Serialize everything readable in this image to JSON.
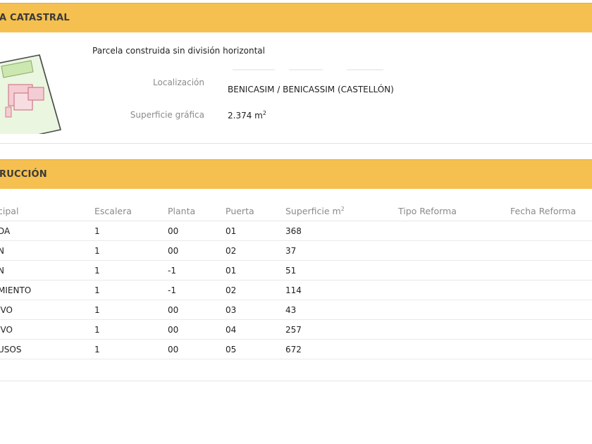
{
  "sections": {
    "catastral": {
      "title": "A CATASTRAL"
    },
    "construccion": {
      "title": "RUCCIÓN"
    }
  },
  "parcel": {
    "description": "Parcela construida sin división horizontal",
    "localizacion_label": "Localización",
    "localizacion_value": "BENICASIM / BENICASSIM (CASTELLÓN)",
    "superficie_label": "Superficie gráfica",
    "superficie_value": "2.374 m",
    "superficie_unit_sup": "2"
  },
  "table": {
    "headers": [
      "cipal",
      "Escalera",
      "Planta",
      "Puerta",
      "Superficie m",
      "Tipo Reforma",
      "Fecha Reforma"
    ],
    "superficie_header_sup": "2",
    "rows": [
      [
        "DA",
        "1",
        "00",
        "01",
        "368",
        "",
        ""
      ],
      [
        "N",
        "1",
        "00",
        "02",
        "37",
        "",
        ""
      ],
      [
        "N",
        "1",
        "-1",
        "01",
        "51",
        "",
        ""
      ],
      [
        "MIENTO",
        "1",
        "-1",
        "02",
        "114",
        "",
        ""
      ],
      [
        "IVO",
        "1",
        "00",
        "03",
        "43",
        "",
        ""
      ],
      [
        "IVO",
        "1",
        "00",
        "04",
        "257",
        "",
        ""
      ],
      [
        "USOS",
        "1",
        "00",
        "05",
        "672",
        "",
        ""
      ]
    ]
  },
  "colors": {
    "header_bg": "#f5c050",
    "parcel_fill": "#e8f5d8",
    "parcel_outline": "#4a4a4a",
    "building_fill": "#f4cdd4",
    "building_outline": "#d27a8a",
    "garden_fill": "#cde7b0"
  },
  "icons": {
    "parcel_map": "parcel-map-thumbnail"
  }
}
